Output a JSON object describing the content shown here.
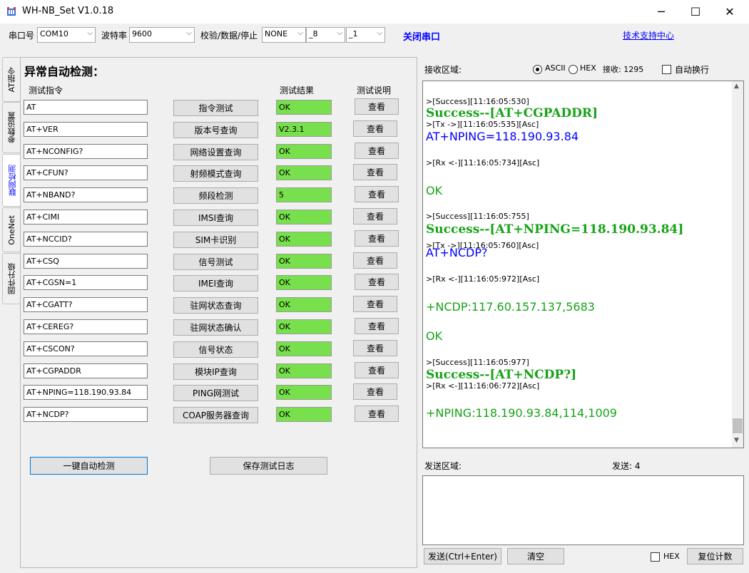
{
  "window": {
    "title": "WH-NB_Set V1.0.18",
    "minimize": "─",
    "maximize": "☐",
    "close": "✕"
  },
  "serial": {
    "port_label": "串口号",
    "port_value": "COM10",
    "baud_label": "波特率",
    "baud_value": "9600",
    "parity_label": "校验/数据/停止",
    "parity_value": "NONE",
    "data_value": "_8",
    "stop_value": "_1",
    "close_port": "关闭串口",
    "support": "技术支持中心"
  },
  "tabs": [
    "AT指令",
    "参数设置",
    "联网检测",
    "OneNet",
    "固件升级"
  ],
  "panel": {
    "title": "异常自动检测：",
    "col_cmd": "测试指令",
    "col_result": "测试结果",
    "col_desc": "测试说明",
    "rows": [
      {
        "cmd": "AT",
        "btn": "指令测试",
        "result": "OK",
        "view": "查看"
      },
      {
        "cmd": "AT+VER",
        "btn": "版本号查询",
        "result": "V2.3.1",
        "view": "查看"
      },
      {
        "cmd": "AT+NCONFIG?",
        "btn": "网络设置查询",
        "result": "OK",
        "view": "查看"
      },
      {
        "cmd": "AT+CFUN?",
        "btn": "射频模式查询",
        "result": "OK",
        "view": "查看"
      },
      {
        "cmd": "AT+NBAND?",
        "btn": "频段检测",
        "result": "5",
        "view": "查看"
      },
      {
        "cmd": "AT+CIMI",
        "btn": "IMSI查询",
        "result": "OK",
        "view": "查看"
      },
      {
        "cmd": "AT+NCCID?",
        "btn": "SIM卡识别",
        "result": "OK",
        "view": "查看"
      },
      {
        "cmd": "AT+CSQ",
        "btn": "信号测试",
        "result": "OK",
        "view": "查看"
      },
      {
        "cmd": "AT+CGSN=1",
        "btn": "IMEI查询",
        "result": "OK",
        "view": "查看"
      },
      {
        "cmd": "AT+CGATT?",
        "btn": "驻网状态查询",
        "result": "OK",
        "view": "查看"
      },
      {
        "cmd": "AT+CEREG?",
        "btn": "驻网状态确认",
        "result": "OK",
        "view": "查看"
      },
      {
        "cmd": "AT+CSCON?",
        "btn": "信号状态",
        "result": "OK",
        "view": "查看"
      },
      {
        "cmd": "AT+CGPADDR",
        "btn": "模块IP查询",
        "result": "OK",
        "view": "查看"
      },
      {
        "cmd": "AT+NPING=118.190.93.84",
        "btn": "PING网测试",
        "result": "OK",
        "view": "查看"
      },
      {
        "cmd": "AT+NCDP?",
        "btn": "COAP服务器查询",
        "result": "OK",
        "view": "查看"
      }
    ],
    "auto_button": "一键自动检测",
    "save_button": "保存测试日志"
  },
  "receive": {
    "label": "接收区域:",
    "ascii": "ASCII",
    "hex": "HEX",
    "count_label": "接收: 1295",
    "auto_wrap": "自动换行",
    "log": [
      {
        "t": "meta",
        "text": ">[Success][11:16:05:530]"
      },
      {
        "t": "success",
        "text": "Success--[AT+CGPADDR]"
      },
      {
        "t": "meta",
        "text": ">[Tx ->][11:16:05:535][Asc]"
      },
      {
        "t": "tx",
        "text": "AT+NPING=118.190.93.84"
      },
      {
        "t": "meta",
        "text": ">[Rx <-][11:16:05:734][Asc]"
      },
      {
        "t": "rx",
        "text": "OK"
      },
      {
        "t": "meta",
        "text": ">[Success][11:16:05:755]"
      },
      {
        "t": "success",
        "text": "Success--[AT+NPING=118.190.93.84]"
      },
      {
        "t": "meta",
        "text": ">[Tx ->][11:16:05:760][Asc]"
      },
      {
        "t": "tx",
        "text": "AT+NCDP?"
      },
      {
        "t": "meta",
        "text": ">[Rx <-][11:16:05:972][Asc]"
      },
      {
        "t": "rx",
        "text": "+NCDP:117.60.157.137,5683"
      },
      {
        "t": "rx",
        "text": "OK"
      },
      {
        "t": "meta",
        "text": ">[Success][11:16:05:977]"
      },
      {
        "t": "success",
        "text": "Success--[AT+NCDP?]"
      },
      {
        "t": "meta",
        "text": ">[Rx <-][11:16:06:772][Asc]"
      },
      {
        "t": "rx",
        "text": "+NPING:118.190.93.84,114,1009"
      }
    ]
  },
  "send": {
    "label": "发送区域:",
    "count_label": "发送: 4",
    "send_button": "发送(Ctrl+Enter)",
    "clear_button": "清空",
    "hex": "HEX",
    "reset_button": "复位计数"
  }
}
